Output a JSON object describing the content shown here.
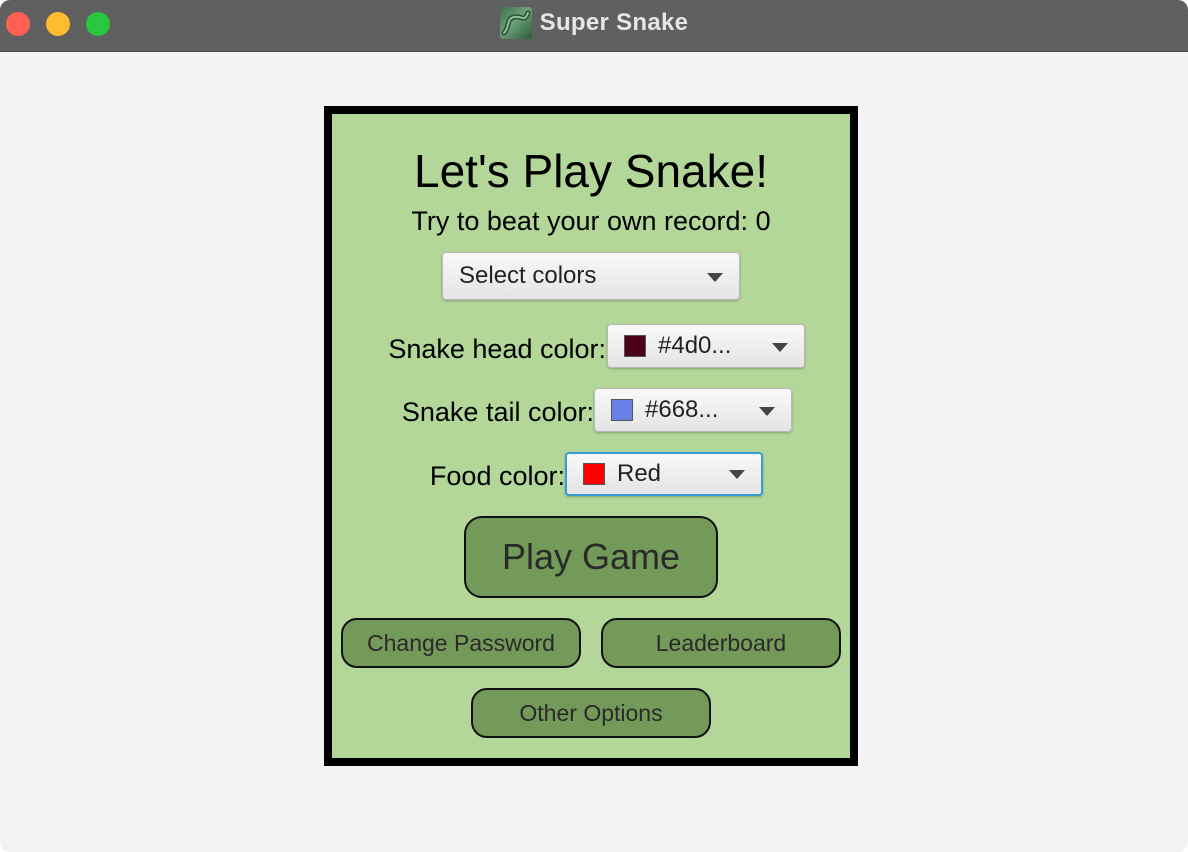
{
  "window": {
    "title": "Super Snake",
    "app_icon": "snake-app-icon"
  },
  "menu": {
    "heading": "Let's Play Snake!",
    "record_label": "Try to beat your own record:",
    "record_value": "0",
    "color_select": {
      "label": "Select colors",
      "icon": "chevron-down-icon"
    },
    "head_color": {
      "label": "Snake head color:",
      "value": "#4d0...",
      "swatch": "#4d0019"
    },
    "tail_color": {
      "label": "Snake tail color:",
      "value": "#668...",
      "swatch": "#6680e6"
    },
    "food_color": {
      "label": "Food color:",
      "value": "Red",
      "swatch": "#ff0000",
      "focus_ring": "#3b9ad9"
    },
    "buttons": {
      "play": "Play Game",
      "change_password": "Change Password",
      "leaderboard": "Leaderboard",
      "other_options": "Other Options"
    }
  },
  "colors": {
    "panel_bg": "#b3d699",
    "button_bg": "#739a58",
    "titlebar": "#5f605f"
  }
}
